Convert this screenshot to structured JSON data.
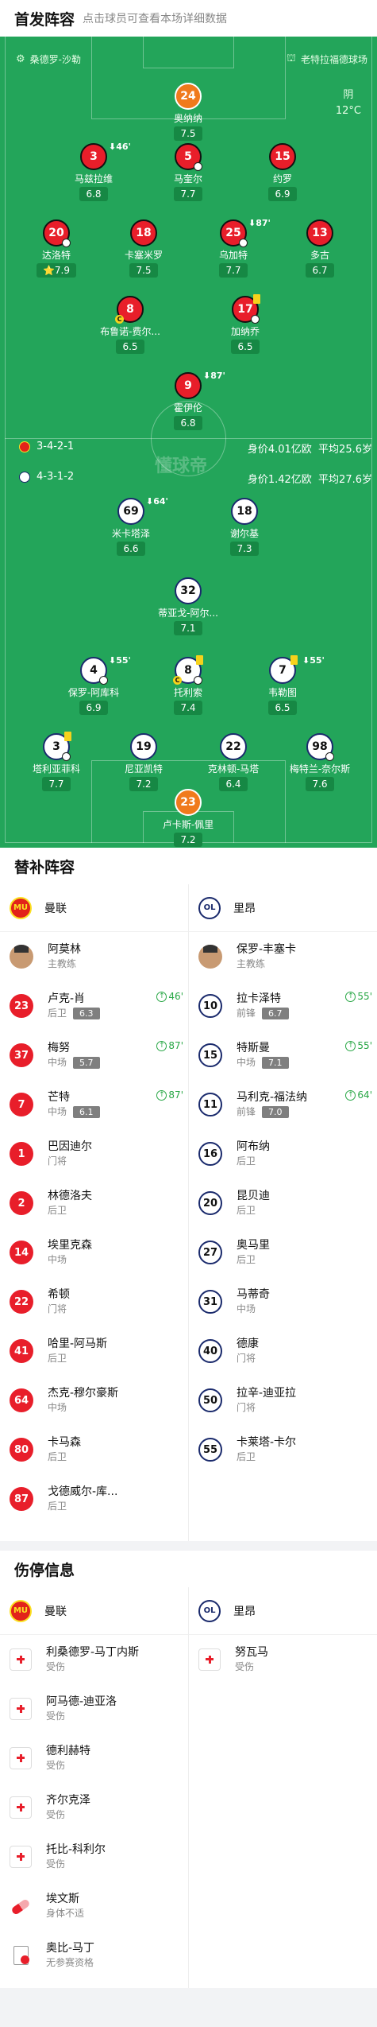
{
  "header": {
    "title": "首发阵容",
    "subtitle": "点击球员可查看本场详细数据"
  },
  "pitch": {
    "home_team": "桑德罗-沙勒",
    "away_team": "老特拉福德球场",
    "weather": {
      "condition": "阴",
      "temp": "12°C"
    },
    "watermark": "懂球帝",
    "home_formation": "3-4-2-1",
    "away_formation": "4-3-1-2",
    "home_value": "身价4.01亿欧",
    "home_age": "平均25.6岁",
    "away_value": "身价1.42亿欧",
    "away_age": "平均27.6岁",
    "home_players": [
      {
        "num": "24",
        "name": "奥纳纳",
        "rating": "7.5",
        "kit": "orange"
      },
      {
        "num": "3",
        "name": "马兹拉维",
        "rating": "6.8",
        "kit": "red",
        "sub": "46'"
      },
      {
        "num": "5",
        "name": "马奎尔",
        "rating": "7.7",
        "kit": "red"
      },
      {
        "num": "15",
        "name": "约罗",
        "rating": "6.9",
        "kit": "red"
      },
      {
        "num": "20",
        "name": "达洛特",
        "rating": "7.9",
        "kit": "red",
        "star": "⭐"
      },
      {
        "num": "18",
        "name": "卡塞米罗",
        "rating": "7.5",
        "kit": "red"
      },
      {
        "num": "25",
        "name": "乌加特",
        "rating": "7.7",
        "kit": "red",
        "sub": "87'"
      },
      {
        "num": "13",
        "name": "多古",
        "rating": "6.7",
        "kit": "red"
      },
      {
        "num": "8",
        "name": "布鲁诺-费尔...",
        "rating": "6.5",
        "kit": "red"
      },
      {
        "num": "17",
        "name": "加纳乔",
        "rating": "6.5",
        "kit": "red"
      },
      {
        "num": "9",
        "name": "霍伊伦",
        "rating": "6.8",
        "kit": "red",
        "sub": "87'"
      }
    ],
    "away_players": [
      {
        "num": "69",
        "name": "米卡塔泽",
        "rating": "6.6",
        "kit": "white",
        "sub": "64'"
      },
      {
        "num": "18",
        "name": "谢尔基",
        "rating": "7.3",
        "kit": "white"
      },
      {
        "num": "32",
        "name": "蒂亚戈-阿尔...",
        "rating": "7.1",
        "kit": "white"
      },
      {
        "num": "4",
        "name": "保罗-阿库科",
        "rating": "6.9",
        "kit": "white",
        "sub": "55'"
      },
      {
        "num": "8",
        "name": "托利索",
        "rating": "7.4",
        "kit": "white"
      },
      {
        "num": "7",
        "name": "韦勒图",
        "rating": "6.5",
        "kit": "white",
        "sub": "55'"
      },
      {
        "num": "3",
        "name": "塔利亚菲科",
        "rating": "7.7",
        "kit": "white"
      },
      {
        "num": "19",
        "name": "尼亚凯特",
        "rating": "7.2",
        "kit": "white"
      },
      {
        "num": "22",
        "name": "克林顿-马塔",
        "rating": "6.4",
        "kit": "white"
      },
      {
        "num": "98",
        "name": "梅特兰-奈尔斯",
        "rating": "7.6",
        "kit": "white"
      },
      {
        "num": "23",
        "name": "卢卡斯-佩里",
        "rating": "7.2",
        "kit": "orange"
      }
    ]
  },
  "subs": {
    "title": "替补阵容",
    "home_team": "曼联",
    "away_team": "里昂",
    "home": [
      {
        "num": "",
        "name": "阿莫林",
        "pos": "主教练",
        "coach": true
      },
      {
        "num": "23",
        "name": "卢克-肖",
        "pos": "后卫",
        "rating": "6.3",
        "time": "46'"
      },
      {
        "num": "37",
        "name": "梅努",
        "pos": "中场",
        "rating": "5.7",
        "time": "87'"
      },
      {
        "num": "7",
        "name": "芒特",
        "pos": "中场",
        "rating": "6.1",
        "time": "87'"
      },
      {
        "num": "1",
        "name": "巴因迪尔",
        "pos": "门将"
      },
      {
        "num": "2",
        "name": "林德洛夫",
        "pos": "后卫"
      },
      {
        "num": "14",
        "name": "埃里克森",
        "pos": "中场"
      },
      {
        "num": "22",
        "name": "希顿",
        "pos": "门将"
      },
      {
        "num": "41",
        "name": "哈里-阿马斯",
        "pos": "后卫"
      },
      {
        "num": "64",
        "name": "杰克-穆尔豪斯",
        "pos": "中场"
      },
      {
        "num": "80",
        "name": "卡马森",
        "pos": "后卫"
      },
      {
        "num": "87",
        "name": "戈德威尔-库...",
        "pos": "后卫"
      }
    ],
    "away": [
      {
        "num": "",
        "name": "保罗-丰塞卡",
        "pos": "主教练",
        "coach": true
      },
      {
        "num": "10",
        "name": "拉卡泽特",
        "pos": "前锋",
        "rating": "6.7",
        "time": "55'"
      },
      {
        "num": "15",
        "name": "特斯曼",
        "pos": "中场",
        "rating": "7.1",
        "time": "55'"
      },
      {
        "num": "11",
        "name": "马利克-福法纳",
        "pos": "前锋",
        "rating": "7.0",
        "time": "64'"
      },
      {
        "num": "16",
        "name": "阿布纳",
        "pos": "后卫"
      },
      {
        "num": "20",
        "name": "昆贝迪",
        "pos": "后卫"
      },
      {
        "num": "27",
        "name": "奥马里",
        "pos": "后卫"
      },
      {
        "num": "31",
        "name": "马蒂奇",
        "pos": "中场"
      },
      {
        "num": "40",
        "name": "德康",
        "pos": "门将"
      },
      {
        "num": "50",
        "name": "拉辛-迪亚拉",
        "pos": "门将"
      },
      {
        "num": "55",
        "name": "卡莱塔-卡尔",
        "pos": "后卫"
      }
    ]
  },
  "injuries": {
    "title": "伤停信息",
    "home_team": "曼联",
    "away_team": "里昂",
    "home": [
      {
        "name": "利桑德罗-马丁内斯",
        "status": "受伤",
        "icon": "medical"
      },
      {
        "name": "阿马德-迪亚洛",
        "status": "受伤",
        "icon": "medical"
      },
      {
        "name": "德利赫特",
        "status": "受伤",
        "icon": "medical"
      },
      {
        "name": "齐尔克泽",
        "status": "受伤",
        "icon": "medical"
      },
      {
        "name": "托比-科利尔",
        "status": "受伤",
        "icon": "medical"
      },
      {
        "name": "埃文斯",
        "status": "身体不适",
        "icon": "pill"
      },
      {
        "name": "奥比-马丁",
        "status": "无参赛资格",
        "icon": "doc"
      }
    ],
    "away": [
      {
        "name": "努瓦马",
        "status": "受伤",
        "icon": "medical"
      }
    ]
  }
}
